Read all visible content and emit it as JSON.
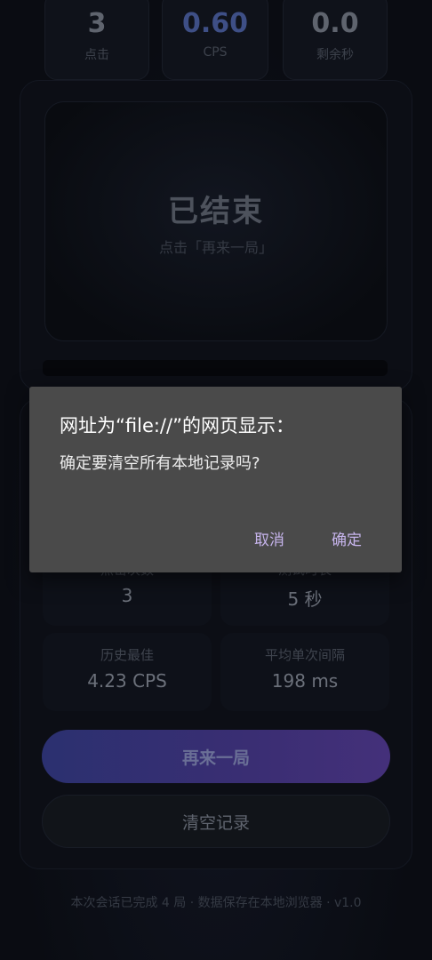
{
  "stats": [
    {
      "value": "3",
      "label": "点击"
    },
    {
      "value": "0.60",
      "label": "CPS"
    },
    {
      "value": "0.0",
      "label": "剩余秒"
    }
  ],
  "click_area": {
    "title": "已结束",
    "hint": "点击「再来一局」"
  },
  "results": {
    "clicks": {
      "label": "点击次数",
      "value": "3"
    },
    "duration": {
      "label": "测试时长",
      "value": "5 秒"
    },
    "best": {
      "label": "历史最佳",
      "value": "4.23 CPS"
    },
    "interval": {
      "label": "平均单次间隔",
      "value": "198 ms"
    }
  },
  "buttons": {
    "again": "再来一局",
    "clear": "清空记录"
  },
  "footer": "本次会话已完成 4 局 · 数据保存在本地浏览器 · v1.0",
  "dialog": {
    "title": "网址为“file://”的网页显示：",
    "message": "确定要清空所有本地记录吗?",
    "cancel": "取消",
    "ok": "确定"
  },
  "colors": {
    "accent": "#3e4f86",
    "dialog_bg": "#4a4a4a",
    "dialog_button": "#c6b4ec"
  }
}
